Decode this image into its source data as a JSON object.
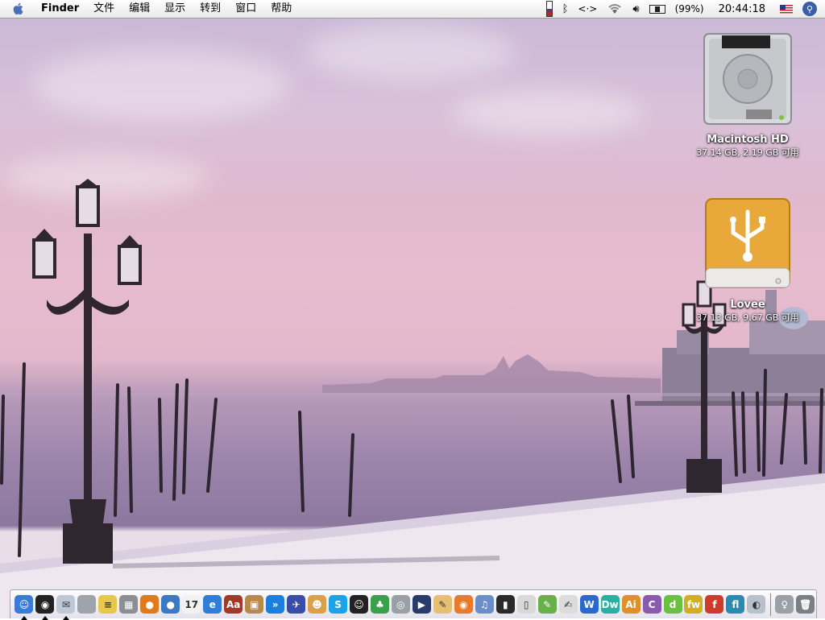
{
  "menubar": {
    "app_name": "Finder",
    "items": [
      "文件",
      "编辑",
      "显示",
      "转到",
      "窗口",
      "帮助"
    ],
    "battery_percent": "(99%)",
    "clock": "20:44:18"
  },
  "desktop_icons": [
    {
      "name": "Macintosh HD",
      "info": "37.14 GB, 2.19 GB 可用"
    },
    {
      "name": "Lovee",
      "info": "37.13 GB, 9.67 GB 可用"
    }
  ],
  "dock": {
    "items": [
      {
        "name": "finder",
        "color": "#3a7bd5",
        "glyph": "☺",
        "running": true
      },
      {
        "name": "dashboard",
        "color": "#222222",
        "glyph": "◉",
        "running": true
      },
      {
        "name": "mail",
        "color": "#bfc8d6",
        "glyph": "✉",
        "running": true
      },
      {
        "name": "system-prefs",
        "color": "#9ea4aa",
        "glyph": ""
      },
      {
        "name": "notes",
        "color": "#e8c84a",
        "glyph": "≡"
      },
      {
        "name": "calculator",
        "color": "#8b8f94",
        "glyph": "▦"
      },
      {
        "name": "firefox",
        "color": "#e07a1f",
        "glyph": "●"
      },
      {
        "name": "thunderbird",
        "color": "#3f78c2",
        "glyph": "●"
      },
      {
        "name": "ical",
        "color": "#f2f2f2",
        "glyph": "17"
      },
      {
        "name": "ie",
        "color": "#2f7ed8",
        "glyph": "e"
      },
      {
        "name": "dictionary",
        "color": "#a23a2a",
        "glyph": "Aa"
      },
      {
        "name": "installer",
        "color": "#b58a4a",
        "glyph": "▣"
      },
      {
        "name": "quicktime-forward",
        "color": "#1b7fe0",
        "glyph": "»"
      },
      {
        "name": "bird-app",
        "color": "#3a4ca8",
        "glyph": "✈"
      },
      {
        "name": "adium",
        "color": "#d9a24a",
        "glyph": "☻"
      },
      {
        "name": "skype",
        "color": "#1aa3e8",
        "glyph": "S"
      },
      {
        "name": "qq",
        "color": "#222222",
        "glyph": "☺"
      },
      {
        "name": "msn",
        "color": "#3aa04a",
        "glyph": "♣"
      },
      {
        "name": "disk-utility",
        "color": "#9aa0a6",
        "glyph": "◎"
      },
      {
        "name": "imovie",
        "color": "#2a3a6a",
        "glyph": "▶"
      },
      {
        "name": "print-app",
        "color": "#e6c070",
        "glyph": "✎"
      },
      {
        "name": "burn",
        "color": "#e87a2a",
        "glyph": "◉"
      },
      {
        "name": "itunes",
        "color": "#6a8fc8",
        "glyph": "♫"
      },
      {
        "name": "terminal",
        "color": "#2a2a2a",
        "glyph": "▮"
      },
      {
        "name": "ipod",
        "color": "#d9d9d9",
        "glyph": "▯"
      },
      {
        "name": "pencil",
        "color": "#6ab04a",
        "glyph": "✎"
      },
      {
        "name": "textedit",
        "color": "#dcdcdc",
        "glyph": "✍"
      },
      {
        "name": "word",
        "color": "#2a6ad0",
        "glyph": "W"
      },
      {
        "name": "dreamweaver",
        "color": "#2ab0a0",
        "glyph": "Dw"
      },
      {
        "name": "illustrator",
        "color": "#e0902a",
        "glyph": "Ai"
      },
      {
        "name": "contribute",
        "color": "#8a5ab0",
        "glyph": "C"
      },
      {
        "name": "dreamweaver-8",
        "color": "#6ac040",
        "glyph": "d"
      },
      {
        "name": "fireworks",
        "color": "#d0b020",
        "glyph": "fw"
      },
      {
        "name": "flash",
        "color": "#d03a2a",
        "glyph": "f"
      },
      {
        "name": "flash-player",
        "color": "#2a8ab0",
        "glyph": "fl"
      },
      {
        "name": "browser-eye",
        "color": "#b8c0cc",
        "glyph": "◐"
      }
    ],
    "trailing": [
      {
        "name": "lamp-app",
        "color": "#9aa0a6",
        "glyph": "♀"
      },
      {
        "name": "trash",
        "color": "#7a7f85",
        "glyph": "🗑"
      }
    ]
  }
}
